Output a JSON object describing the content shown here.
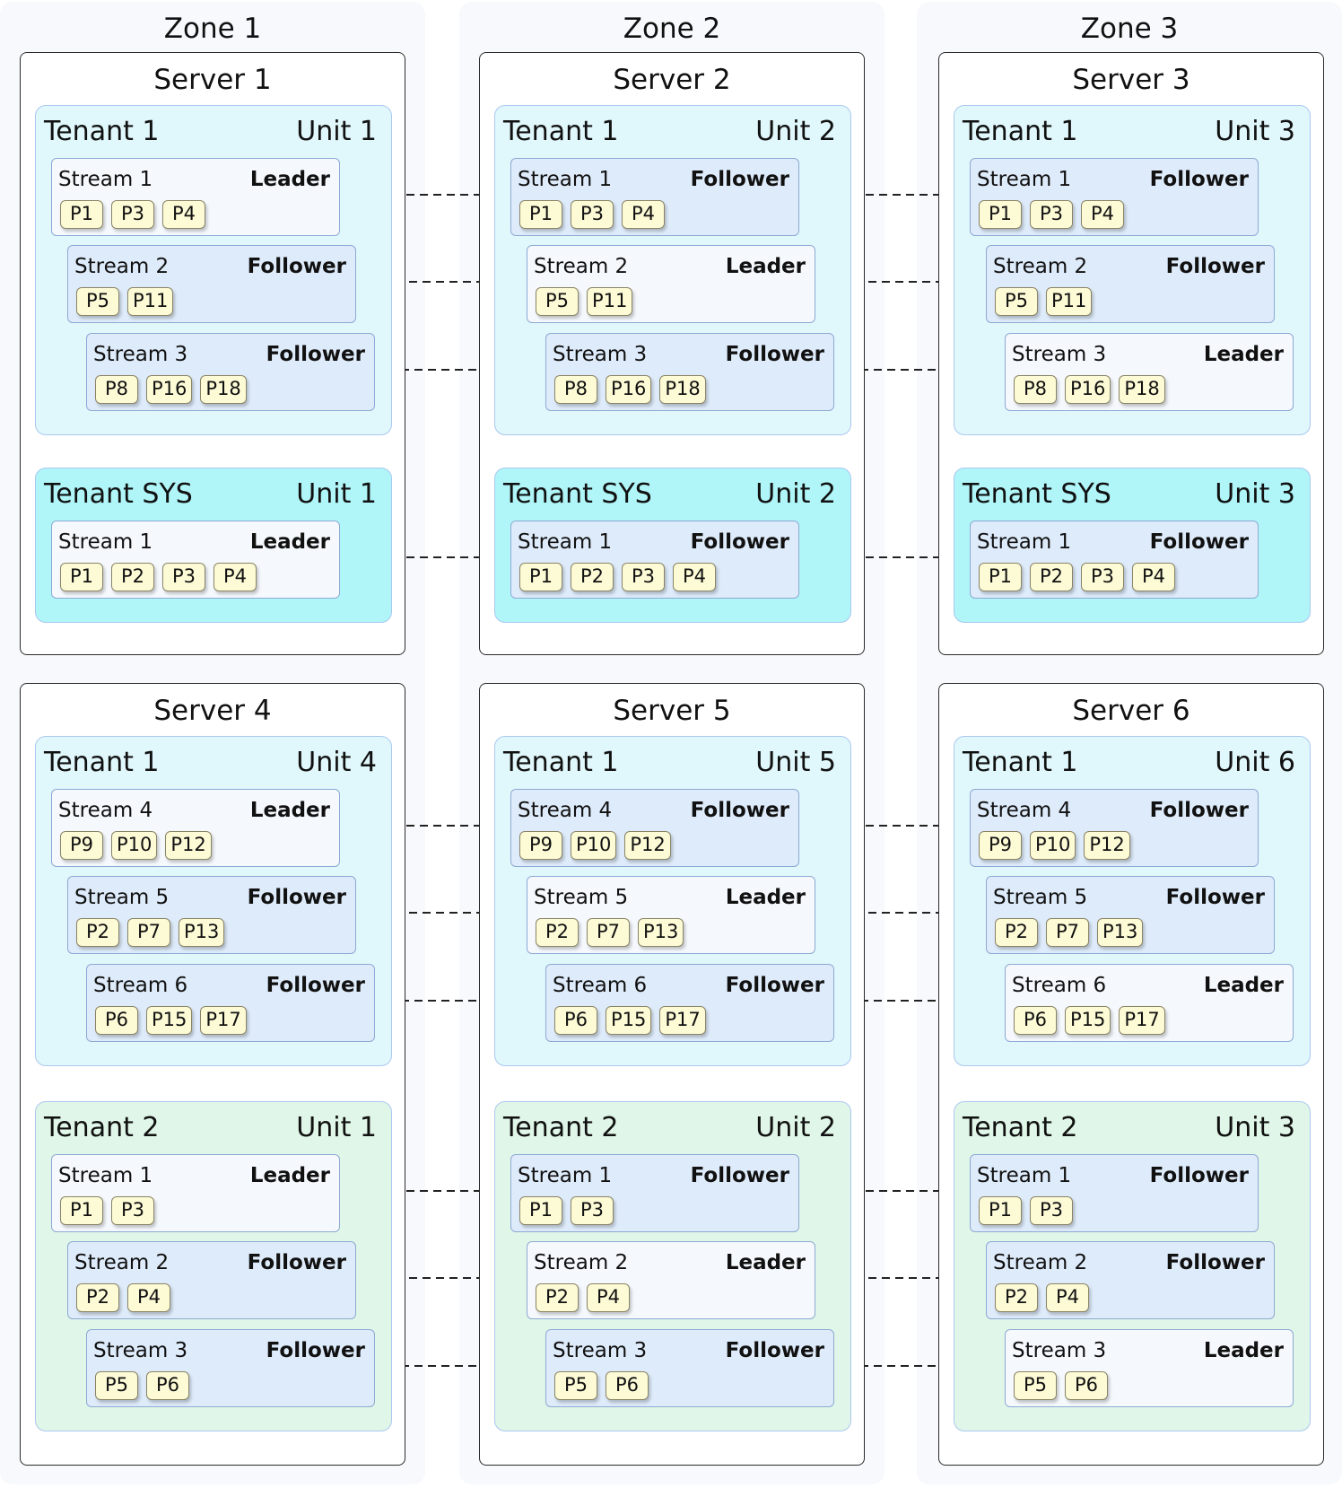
{
  "zones": [
    {
      "title": "Zone 1"
    },
    {
      "title": "Zone 2"
    },
    {
      "title": "Zone 3"
    }
  ],
  "servers": [
    {
      "title": "Server 1",
      "tenants": [
        {
          "name": "Tenant 1",
          "unit": "Unit 1",
          "kind": "t1",
          "streams": [
            {
              "name": "Stream 1",
              "role": "Leader",
              "partitions": [
                "P1",
                "P3",
                "P4"
              ]
            },
            {
              "name": "Stream 2",
              "role": "Follower",
              "partitions": [
                "P5",
                "P11"
              ]
            },
            {
              "name": "Stream 3",
              "role": "Follower",
              "partitions": [
                "P8",
                "P16",
                "P18"
              ]
            }
          ]
        },
        {
          "name": "Tenant SYS",
          "unit": "Unit 1",
          "kind": "sys",
          "streams": [
            {
              "name": "Stream 1",
              "role": "Leader",
              "partitions": [
                "P1",
                "P2",
                "P3",
                "P4"
              ]
            }
          ]
        }
      ]
    },
    {
      "title": "Server 2",
      "tenants": [
        {
          "name": "Tenant 1",
          "unit": "Unit 2",
          "kind": "t1",
          "streams": [
            {
              "name": "Stream 1",
              "role": "Follower",
              "partitions": [
                "P1",
                "P3",
                "P4"
              ]
            },
            {
              "name": "Stream 2",
              "role": "Leader",
              "partitions": [
                "P5",
                "P11"
              ]
            },
            {
              "name": "Stream 3",
              "role": "Follower",
              "partitions": [
                "P8",
                "P16",
                "P18"
              ]
            }
          ]
        },
        {
          "name": "Tenant SYS",
          "unit": "Unit 2",
          "kind": "sys",
          "streams": [
            {
              "name": "Stream 1",
              "role": "Follower",
              "partitions": [
                "P1",
                "P2",
                "P3",
                "P4"
              ]
            }
          ]
        }
      ]
    },
    {
      "title": "Server 3",
      "tenants": [
        {
          "name": "Tenant 1",
          "unit": "Unit 3",
          "kind": "t1",
          "streams": [
            {
              "name": "Stream 1",
              "role": "Follower",
              "partitions": [
                "P1",
                "P3",
                "P4"
              ]
            },
            {
              "name": "Stream 2",
              "role": "Follower",
              "partitions": [
                "P5",
                "P11"
              ]
            },
            {
              "name": "Stream 3",
              "role": "Leader",
              "partitions": [
                "P8",
                "P16",
                "P18"
              ]
            }
          ]
        },
        {
          "name": "Tenant SYS",
          "unit": "Unit 3",
          "kind": "sys",
          "streams": [
            {
              "name": "Stream 1",
              "role": "Follower",
              "partitions": [
                "P1",
                "P2",
                "P3",
                "P4"
              ]
            }
          ]
        }
      ]
    },
    {
      "title": "Server 4",
      "tenants": [
        {
          "name": "Tenant 1",
          "unit": "Unit 4",
          "kind": "t1",
          "streams": [
            {
              "name": "Stream 4",
              "role": "Leader",
              "partitions": [
                "P9",
                "P10",
                "P12"
              ]
            },
            {
              "name": "Stream 5",
              "role": "Follower",
              "partitions": [
                "P2",
                "P7",
                "P13"
              ]
            },
            {
              "name": "Stream 6",
              "role": "Follower",
              "partitions": [
                "P6",
                "P15",
                "P17"
              ]
            }
          ]
        },
        {
          "name": "Tenant 2",
          "unit": "Unit 1",
          "kind": "t2",
          "streams": [
            {
              "name": "Stream 1",
              "role": "Leader",
              "partitions": [
                "P1",
                "P3"
              ]
            },
            {
              "name": "Stream 2",
              "role": "Follower",
              "partitions": [
                "P2",
                "P4"
              ]
            },
            {
              "name": "Stream 3",
              "role": "Follower",
              "partitions": [
                "P5",
                "P6"
              ]
            }
          ]
        }
      ]
    },
    {
      "title": "Server 5",
      "tenants": [
        {
          "name": "Tenant 1",
          "unit": "Unit 5",
          "kind": "t1",
          "streams": [
            {
              "name": "Stream 4",
              "role": "Follower",
              "partitions": [
                "P9",
                "P10",
                "P12"
              ]
            },
            {
              "name": "Stream 5",
              "role": "Leader",
              "partitions": [
                "P2",
                "P7",
                "P13"
              ]
            },
            {
              "name": "Stream 6",
              "role": "Follower",
              "partitions": [
                "P6",
                "P15",
                "P17"
              ]
            }
          ]
        },
        {
          "name": "Tenant 2",
          "unit": "Unit 2",
          "kind": "t2",
          "streams": [
            {
              "name": "Stream 1",
              "role": "Follower",
              "partitions": [
                "P1",
                "P3"
              ]
            },
            {
              "name": "Stream 2",
              "role": "Leader",
              "partitions": [
                "P2",
                "P4"
              ]
            },
            {
              "name": "Stream 3",
              "role": "Follower",
              "partitions": [
                "P5",
                "P6"
              ]
            }
          ]
        }
      ]
    },
    {
      "title": "Server 6",
      "tenants": [
        {
          "name": "Tenant 1",
          "unit": "Unit 6",
          "kind": "t1",
          "streams": [
            {
              "name": "Stream 4",
              "role": "Follower",
              "partitions": [
                "P9",
                "P10",
                "P12"
              ]
            },
            {
              "name": "Stream 5",
              "role": "Follower",
              "partitions": [
                "P2",
                "P7",
                "P13"
              ]
            },
            {
              "name": "Stream 6",
              "role": "Leader",
              "partitions": [
                "P6",
                "P15",
                "P17"
              ]
            }
          ]
        },
        {
          "name": "Tenant 2",
          "unit": "Unit 3",
          "kind": "t2",
          "streams": [
            {
              "name": "Stream 1",
              "role": "Follower",
              "partitions": [
                "P1",
                "P3"
              ]
            },
            {
              "name": "Stream 2",
              "role": "Follower",
              "partitions": [
                "P2",
                "P4"
              ]
            },
            {
              "name": "Stream 3",
              "role": "Leader",
              "partitions": [
                "P5",
                "P6"
              ]
            }
          ]
        }
      ]
    }
  ]
}
